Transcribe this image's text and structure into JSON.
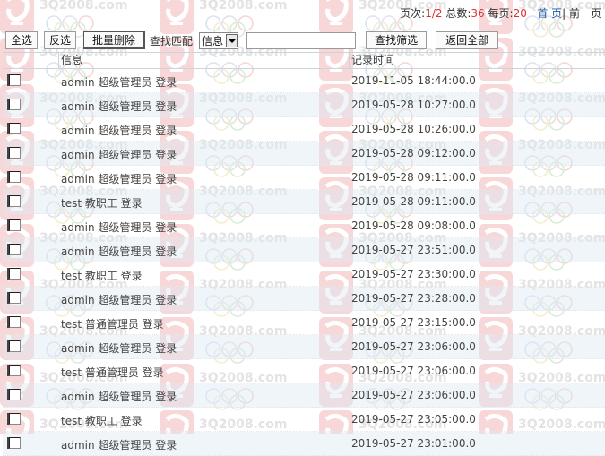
{
  "pager": {
    "page_label": "页次:",
    "page_value": "1/2",
    "total_label": "总数:",
    "total_value": "36",
    "per_page_label": "每页:",
    "per_page_value": "20",
    "first_link": "首 页",
    "prev_link": "前一页"
  },
  "toolbar": {
    "select_all": "全选",
    "invert": "反选",
    "batch_delete": "批量删除",
    "match_label": "查找匹配",
    "match_select_value": "信息",
    "search_value": "",
    "filter_button": "查找筛选",
    "return_all": "返回全部"
  },
  "table": {
    "headers": {
      "info": "信息",
      "time": "记录时间"
    },
    "rows": [
      {
        "info": "admin 超级管理员 登录",
        "time": "2019-11-05 18:44:00.0"
      },
      {
        "info": "admin 超级管理员 登录",
        "time": "2019-05-28 10:27:00.0"
      },
      {
        "info": "admin 超级管理员 登录",
        "time": "2019-05-28 10:26:00.0"
      },
      {
        "info": "admin 超级管理员 登录",
        "time": "2019-05-28 09:12:00.0"
      },
      {
        "info": "admin 超级管理员 登录",
        "time": "2019-05-28 09:11:00.0"
      },
      {
        "info": "test 教职工 登录",
        "time": "2019-05-28 09:11:00.0"
      },
      {
        "info": "admin 超级管理员 登录",
        "time": "2019-05-28 09:08:00.0"
      },
      {
        "info": "admin 超级管理员 登录",
        "time": "2019-05-27 23:51:00.0"
      },
      {
        "info": "test 教职工 登录",
        "time": "2019-05-27 23:30:00.0"
      },
      {
        "info": "admin 超级管理员 登录",
        "time": "2019-05-27 23:28:00.0"
      },
      {
        "info": "test 普通管理员 登录",
        "time": "2019-05-27 23:15:00.0"
      },
      {
        "info": "admin 超级管理员 登录",
        "time": "2019-05-27 23:06:00.0"
      },
      {
        "info": "test 普通管理员 登录",
        "time": "2019-05-27 23:06:00.0"
      },
      {
        "info": "admin 超级管理员 登录",
        "time": "2019-05-27 23:06:00.0"
      },
      {
        "info": "test 教职工 登录",
        "time": "2019-05-27 23:05:00.0"
      },
      {
        "info": "admin 超级管理员 登录",
        "time": "2019-05-27 23:01:00.0"
      }
    ]
  },
  "watermark": {
    "text": "3Q2008.com"
  }
}
